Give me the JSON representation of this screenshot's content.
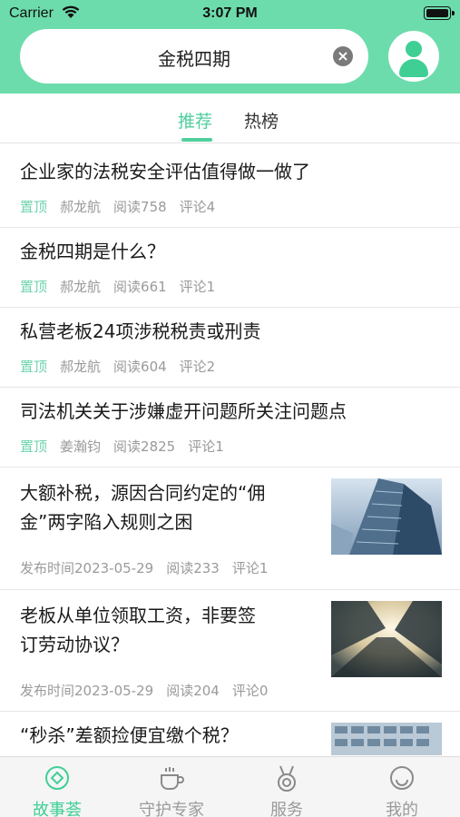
{
  "status_bar": {
    "carrier": "Carrier",
    "time": "3:07 PM"
  },
  "search": {
    "query": "金税四期"
  },
  "tabs": [
    {
      "label": "推荐",
      "active": true
    },
    {
      "label": "热榜",
      "active": false
    }
  ],
  "articles": [
    {
      "title": "企业家的法税安全评估值得做一做了",
      "pin": "置顶",
      "author": "郝龙航",
      "reads": "阅读758",
      "comments": "评论4"
    },
    {
      "title": "金税四期是什么？",
      "pin": "置顶",
      "author": "郝龙航",
      "reads": "阅读661",
      "comments": "评论1"
    },
    {
      "title": "私营老板24项涉税税责或刑责",
      "pin": "置顶",
      "author": "郝龙航",
      "reads": "阅读604",
      "comments": "评论2"
    },
    {
      "title": "司法机关关于涉嫌虚开问题所关注问题点",
      "pin": "置顶",
      "author": "姜瀚钧",
      "reads": "阅读2825",
      "comments": "评论1"
    },
    {
      "title_line1": "大额补税，源因合同约定的“佣",
      "title_line2": "金”两字陷入规则之困",
      "date": "发布时间2023-05-29",
      "reads": "阅读233",
      "comments": "评论1"
    },
    {
      "title_line1": "老板从单位领取工资，非要签",
      "title_line2": "订劳动协议？",
      "date": "发布时间2023-05-29",
      "reads": "阅读204",
      "comments": "评论0"
    },
    {
      "title": "“秒杀”差额捡便宜缴个税？"
    }
  ],
  "tabbar": [
    {
      "label": "故事荟",
      "icon": "story-icon",
      "active": true
    },
    {
      "label": "守护专家",
      "icon": "coffee-cup-icon",
      "active": false
    },
    {
      "label": "服务",
      "icon": "medal-icon",
      "active": false
    },
    {
      "label": "我的",
      "icon": "smiley-icon",
      "active": false
    }
  ],
  "colors": {
    "header": "#6ddcac",
    "accent": "#4fcf9c",
    "pin": "#6fd3ae",
    "meta": "#9a9a9a"
  }
}
